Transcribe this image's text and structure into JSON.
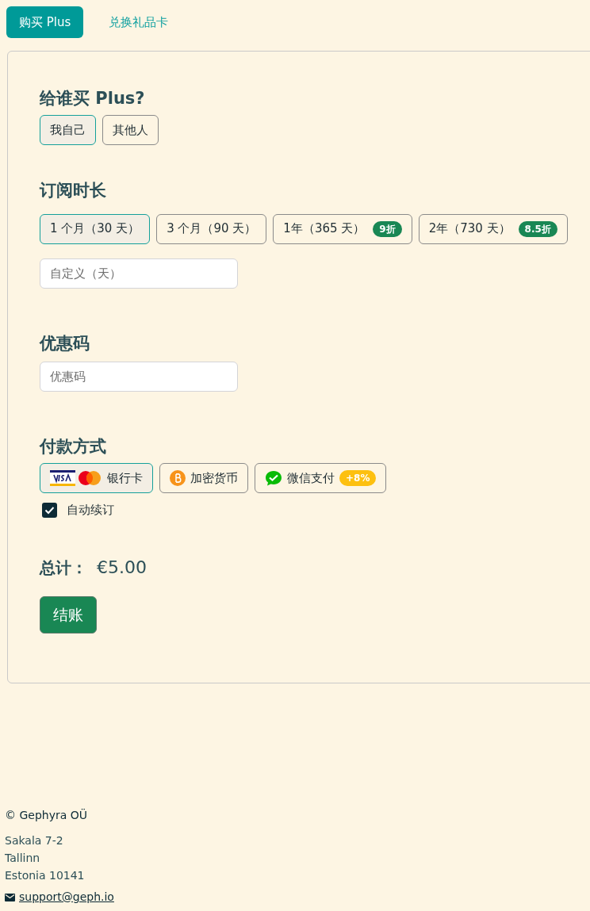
{
  "tabs": [
    {
      "label": "购买 Plus",
      "selected": true
    },
    {
      "label": "兑换礼品卡",
      "selected": false
    }
  ],
  "recipient": {
    "title": "给谁买 Plus?",
    "options": [
      {
        "label": "我自己",
        "selected": true
      },
      {
        "label": "其他人",
        "selected": false
      }
    ]
  },
  "duration": {
    "title": "订阅时长",
    "options": [
      {
        "label": "1 个月（30 天）",
        "selected": true
      },
      {
        "label": "3 个月（90 天）",
        "selected": false
      },
      {
        "label": "1年（365 天）",
        "badge": "9折",
        "selected": false
      },
      {
        "label": "2年（730 天）",
        "badge": "8.5折",
        "selected": false
      }
    ],
    "custom_placeholder": "自定义（天）"
  },
  "promo": {
    "title": "优惠码",
    "placeholder": "优惠码"
  },
  "payment": {
    "title": "付款方式",
    "methods": [
      {
        "kind": "card",
        "label": "银行卡",
        "selected": true
      },
      {
        "kind": "crypto",
        "label": "加密货币",
        "selected": false
      },
      {
        "kind": "wechat",
        "label": "微信支付",
        "badge": "+8%",
        "selected": false
      }
    ],
    "auto_renew": {
      "label": "自动续订",
      "checked": true
    }
  },
  "total": {
    "label": "总计：",
    "amount": "€5.00"
  },
  "checkout_button": "结账",
  "footer": {
    "company": "© Gephyra OÜ",
    "address": [
      "Sakala 7-2",
      "Tallinn",
      "Estonia 10141"
    ],
    "email": "support@geph.io"
  }
}
